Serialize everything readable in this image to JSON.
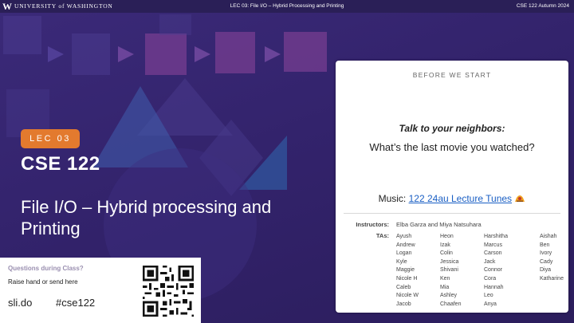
{
  "topbar": {
    "logo_letter": "W",
    "university": "UNIVERSITY of WASHINGTON",
    "lecture": "LEC 03: File I/O – Hybrid Processing and Printing",
    "course_term": "CSE 122 Autumn 2024"
  },
  "hero": {
    "badge": "LEC 03",
    "course": "CSE 122",
    "title": "File I/O – Hybrid processing and Printing"
  },
  "questions": {
    "heading": "Questions during Class?",
    "subtitle": "Raise hand or send here",
    "site": "sli.do",
    "tag": "#cse122"
  },
  "card": {
    "heading": "BEFORE WE START",
    "prompt_label": "Talk to your neighbors:",
    "prompt_question": "What’s the last movie you watched?",
    "music_label": "Music:",
    "music_link": "122 24au Lecture Tunes",
    "instructors_label": "Instructors:",
    "instructors": "Elba Garza and Miya Natsuhara",
    "tas_label": "TAs:",
    "ta_columns": [
      [
        "Ayush",
        "Andrew",
        "Logan",
        "Kyle",
        "Maggie",
        "Nicole H",
        "Caleb",
        "Nicole W",
        "Jacob"
      ],
      [
        "Heon",
        "Izak",
        "Colin",
        "Jessica",
        "Shivani",
        "Ken",
        "Mia",
        "Ashley",
        "Chaafen"
      ],
      [
        "Harshitha",
        "Marcus",
        "Carson",
        "Jack",
        "Connor",
        "Cora",
        "Hannah",
        "Leo",
        "Anya"
      ],
      [
        "Aishah",
        "Ben",
        "Ivory",
        "Cady",
        "Diya",
        "Katharine"
      ]
    ]
  },
  "colors": {
    "background": "#33236c",
    "accent_orange": "#e37a2e",
    "link_blue": "#1a5fc4"
  }
}
